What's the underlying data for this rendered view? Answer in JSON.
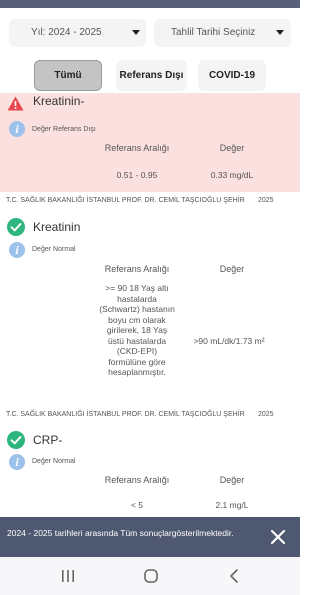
{
  "filters": {
    "year_label": "Yıl: 2024 - 2025",
    "date_label": "Tahlil Tarihi Seçiniz"
  },
  "tabs": [
    {
      "label": "Tümü",
      "selected": true
    },
    {
      "label": "Referans Dışı",
      "selected": false
    },
    {
      "label": "COVID-19",
      "selected": false
    }
  ],
  "tests": [
    {
      "name": "Kreatinin-",
      "status": "Değer Referans Dışı",
      "out_of_range": true,
      "range_header": "Referans Aralığı",
      "value_header": "Değer",
      "range": "0.51 - 0.95",
      "value": "0.33 mg/dL"
    },
    {
      "name": "Kreatinin",
      "status": "Değer Normal",
      "out_of_range": false,
      "institution": "T.C. SAĞLIK BAKANLIĞI İSTANBUL PROF. DR. CEMİL TAŞCIOĞLU ŞEHİR",
      "date": "2025",
      "range_header": "Referans Aralığı",
      "value_header": "Değer",
      "range": ">= 90 18 Yaş altı hastalarda (Schwartz) hastanın boyu cm olarak girilerek, 18 Yaş üstü hastalarda (CKD-EPI) formülüne göre hesaplanmıştır.",
      "value": ">90 mL/dk/1.73 m²"
    },
    {
      "name": "CRP-",
      "status": "Değer Normal",
      "out_of_range": false,
      "institution": "T.C. SAĞLIK BAKANLIĞI İSTANBUL PROF. DR. CEMİL TAŞCIOĞLU ŞEHİR",
      "date": "2025",
      "range_header": "Referans Aralığı",
      "value_header": "Değer",
      "range": "< 5",
      "value": "2.1 mg/L"
    }
  ],
  "snackbar": {
    "message": "2024 - 2025 tarihleri arasında Tüm sonuçlargösterilmektedir."
  },
  "colors": {
    "alert_bg": "#fbe0e0",
    "alert_icon": "#e8484d",
    "normal_icon": "#2cb67d",
    "info_icon": "#9cc1ea",
    "snackbar_bg": "#4f5871"
  },
  "icons": {
    "alert": "warning-triangle-icon",
    "normal": "check-circle-icon",
    "info": "info-icon",
    "dropdown": "caret-down-icon",
    "close": "close-icon",
    "nav_recents": "recents-icon",
    "nav_home": "home-icon",
    "nav_back": "back-icon"
  }
}
